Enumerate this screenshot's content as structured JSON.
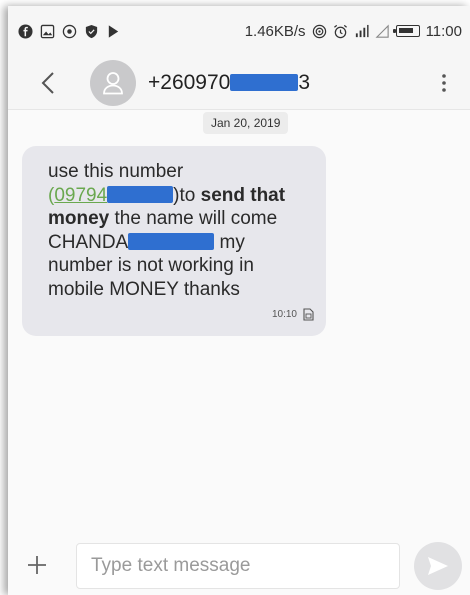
{
  "status_bar": {
    "net_speed": "1.46KB/s",
    "time": "11:00",
    "battery_level": 0.8,
    "icons": [
      "facebook-icon",
      "gallery-icon",
      "circle-dot-icon",
      "shield-icon",
      "play-store-icon",
      "hotspot-icon",
      "alarm-icon",
      "signal-icon",
      "no-signal-icon",
      "battery-icon"
    ]
  },
  "header": {
    "contact_prefix": "+260970",
    "contact_suffix": "3",
    "icons": [
      "back-icon",
      "person-icon",
      "more-vert-icon"
    ]
  },
  "conversation": {
    "date": "Jan 20, 2019",
    "message": {
      "line1": "use this number",
      "open_paren": "(",
      "number_prefix": "09794",
      "part_to": ")to ",
      "bold1": "send that",
      "bold2": "money",
      "part_after_money": " the name will come",
      "name_prefix": "CHANDA",
      "part_my": " my",
      "line5": "number is not working in",
      "line6": "mobile MONEY thanks",
      "time": "10:10",
      "status_icon": "sim-icon"
    }
  },
  "composer": {
    "placeholder": "Type text message",
    "value": "",
    "icons": [
      "plus-icon",
      "send-icon"
    ]
  },
  "colors": {
    "redaction": "#2f6fd0",
    "link": "#6aa84f",
    "bubble": "#e7e7ec"
  }
}
